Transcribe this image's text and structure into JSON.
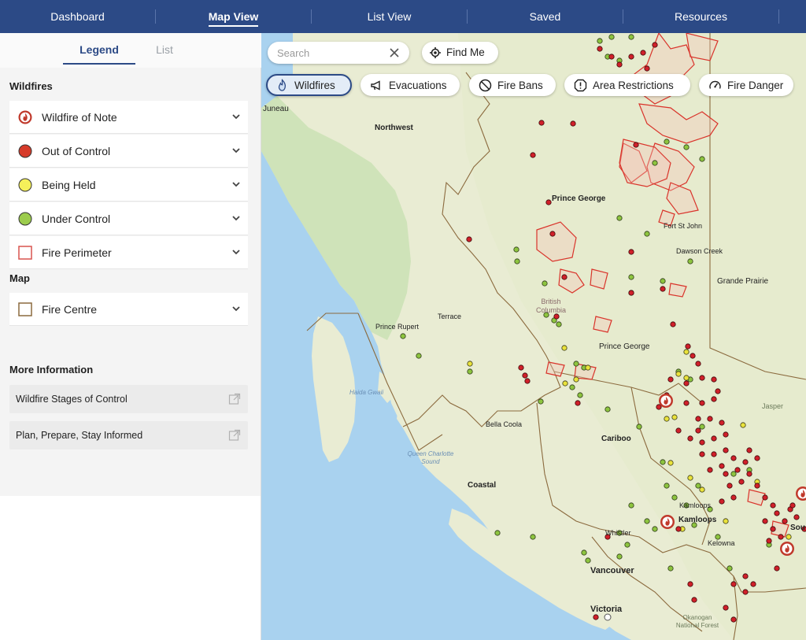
{
  "nav": {
    "items": [
      {
        "label": "Dashboard"
      },
      {
        "label": "Map View"
      },
      {
        "label": "List View"
      },
      {
        "label": "Saved"
      },
      {
        "label": "Resources"
      }
    ]
  },
  "sidebar": {
    "tabs": {
      "legend": "Legend",
      "list": "List"
    },
    "wildfires_title": "Wildfires",
    "legend_items": [
      {
        "label": "Wildfire of Note",
        "icon": "wildfire-of-note-icon",
        "color": "#c0392b"
      },
      {
        "label": "Out of Control",
        "icon": "red-dot-icon",
        "color": "#d63b2a"
      },
      {
        "label": "Being Held",
        "icon": "yellow-dot-icon",
        "color": "#f5f05a"
      },
      {
        "label": "Under Control",
        "icon": "green-dot-icon",
        "color": "#9ccc4d"
      },
      {
        "label": "Fire Perimeter",
        "icon": "perimeter-square-icon",
        "color": "#d9534f"
      }
    ],
    "map_title": "Map",
    "map_items": [
      {
        "label": "Fire Centre",
        "icon": "fire-centre-square-icon",
        "color": "#8b6a3e"
      }
    ],
    "more_info_title": "More Information",
    "info_links": [
      {
        "label": "Wildfire Stages of Control"
      },
      {
        "label": "Plan, Prepare, Stay Informed"
      }
    ]
  },
  "map": {
    "search_placeholder": "Search",
    "find_me": "Find Me",
    "chips": [
      {
        "label": "Wildfires",
        "icon": "flame-icon",
        "active": true
      },
      {
        "label": "Evacuations",
        "icon": "megaphone-icon",
        "active": false
      },
      {
        "label": "Fire Bans",
        "icon": "no-symbol-icon",
        "active": false
      },
      {
        "label": "Area Restrictions",
        "icon": "warning-icon",
        "active": false
      },
      {
        "label": "Fire Danger",
        "icon": "gauge-icon",
        "active": false
      }
    ],
    "labels": {
      "juneau": "Juneau",
      "northwest": "Northwest",
      "prince_george_region": "Prince George",
      "fort_st_john": "Fort St John",
      "dawson_creek": "Dawson Creek",
      "grande_prairie": "Grande Prairie",
      "british_columbia": "British Columbia",
      "terrace": "Terrace",
      "prince_rupert": "Prince Rupert",
      "prince_george_city": "Prince George",
      "haida_gwaii": "Haida Gwaii",
      "bella_coola": "Bella Coola",
      "cariboo": "Cariboo",
      "queen_charlotte": "Queen Charlotte Sound",
      "jasper": "Jasper",
      "coastal": "Coastal",
      "kamloops_small": "Kamloops",
      "kamloops_region": "Kamloops",
      "whistler": "Whistler",
      "kelowna": "Kelowna",
      "vancouver": "Vancouver",
      "victoria": "Victoria",
      "okanogan": "Okanogan National Forest",
      "south": "Sou"
    },
    "colors": {
      "out_of_control": "#d0202a",
      "being_held": "#e9e23c",
      "under_control": "#8dc43f",
      "perimeter": "#d9342b",
      "boundary": "#8b6a3e",
      "water": "#a9d2ef",
      "land": "#e9ecd3"
    }
  }
}
